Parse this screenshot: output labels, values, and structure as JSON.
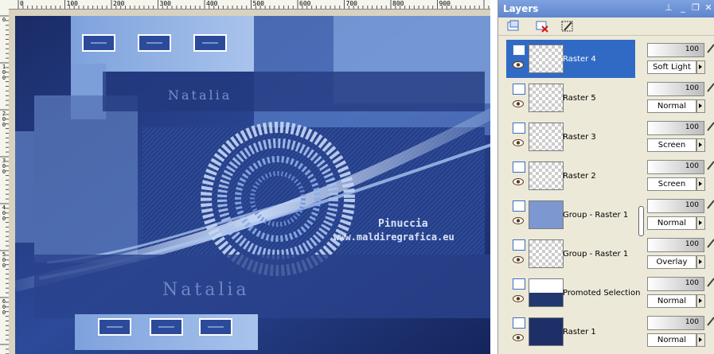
{
  "ruler": {
    "horizontal": [
      "0",
      "100",
      "200",
      "300",
      "400",
      "500",
      "600",
      "700",
      "800",
      "900"
    ],
    "vertical": [
      "0",
      "1\n0\n0",
      "2\n0\n0",
      "3\n0\n0",
      "4\n0\n0",
      "5\n0\n0",
      "6\n0\n0"
    ]
  },
  "canvas": {
    "watermark_text_1": "Pinuccia",
    "watermark_text_2": "www.maldiregrafica.eu",
    "signature": "Natalia"
  },
  "layers_panel": {
    "title": "Layers",
    "titlebar_icons": [
      "pin-icon",
      "minimize-icon",
      "restore-icon",
      "close-icon"
    ],
    "toolbar_icons": [
      "new-layer-icon",
      "delete-layer-icon",
      "mask-icon"
    ],
    "layers": [
      {
        "name": "Raster 4",
        "opacity": "100",
        "blend": "Soft Light",
        "selected": true
      },
      {
        "name": "Raster 5",
        "opacity": "100",
        "blend": "Normal",
        "selected": false
      },
      {
        "name": "Raster 3",
        "opacity": "100",
        "blend": "Screen",
        "selected": false
      },
      {
        "name": "Raster 2",
        "opacity": "100",
        "blend": "Screen",
        "selected": false
      },
      {
        "name": "Group - Raster 1",
        "opacity": "100",
        "blend": "Normal",
        "selected": false
      },
      {
        "name": "Group - Raster 1",
        "opacity": "100",
        "blend": "Overlay",
        "selected": false
      },
      {
        "name": "Promoted Selection",
        "opacity": "100",
        "blend": "Normal",
        "selected": false
      },
      {
        "name": "Raster 1",
        "opacity": "100",
        "blend": "Normal",
        "selected": false
      }
    ]
  },
  "colors": {
    "titlebar": "#6a8ed6",
    "selection": "#316ac5",
    "panel_bg": "#ece9d8",
    "image_dark": "#1e2f68",
    "image_light": "#8aaee4"
  }
}
